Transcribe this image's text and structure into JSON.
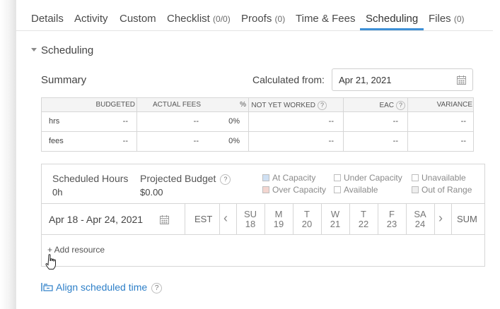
{
  "tabs": [
    {
      "label": "Details",
      "count": ""
    },
    {
      "label": "Activity",
      "count": ""
    },
    {
      "label": "Custom",
      "count": ""
    },
    {
      "label": "Checklist",
      "count": "(0/0)"
    },
    {
      "label": "Proofs",
      "count": "(0)"
    },
    {
      "label": "Time & Fees",
      "count": ""
    },
    {
      "label": "Scheduling",
      "count": ""
    },
    {
      "label": "Files",
      "count": "(0)"
    }
  ],
  "active_tab": "Scheduling",
  "section": {
    "title": "Scheduling"
  },
  "summary": {
    "label": "Summary",
    "calculated_from_label": "Calculated from:",
    "calculated_from_value": "Apr 21, 2021",
    "columns": [
      "BUDGETED",
      "ACTUAL FEES",
      "%",
      "NOT YET WORKED",
      "EAC",
      "VARIANCE"
    ],
    "rows": [
      {
        "label": "hrs",
        "budgeted": "--",
        "actual": "--",
        "pct": "0%",
        "nyw": "--",
        "eac": "--",
        "variance": "--"
      },
      {
        "label": "fees",
        "budgeted": "--",
        "actual": "--",
        "pct": "0%",
        "nyw": "--",
        "eac": "--",
        "variance": "--"
      }
    ]
  },
  "scheduled": {
    "hours_label": "Scheduled Hours",
    "hours_value": "0h",
    "budget_label": "Projected Budget",
    "budget_value": "$0.00",
    "help": "?",
    "legend": [
      {
        "label": "At Capacity",
        "color": "#cfe0f3"
      },
      {
        "label": "Under Capacity",
        "color": "#ffffff"
      },
      {
        "label": "Unavailable",
        "color": "#ffffff"
      },
      {
        "label": "Over Capacity",
        "color": "#f3d6d0"
      },
      {
        "label": "Available",
        "color": "#ffffff"
      },
      {
        "label": "Out of Range",
        "color": "#eeeeee"
      }
    ],
    "week_range": "Apr 18 - Apr 24, 2021",
    "timezone": "EST",
    "days": [
      {
        "d": "SU",
        "n": "18"
      },
      {
        "d": "M",
        "n": "19"
      },
      {
        "d": "T",
        "n": "20"
      },
      {
        "d": "W",
        "n": "21"
      },
      {
        "d": "T",
        "n": "22"
      },
      {
        "d": "F",
        "n": "23"
      },
      {
        "d": "SA",
        "n": "24"
      }
    ],
    "sum_label": "SUM",
    "add_resource": "+ Add resource"
  },
  "align_link": "Align scheduled time"
}
